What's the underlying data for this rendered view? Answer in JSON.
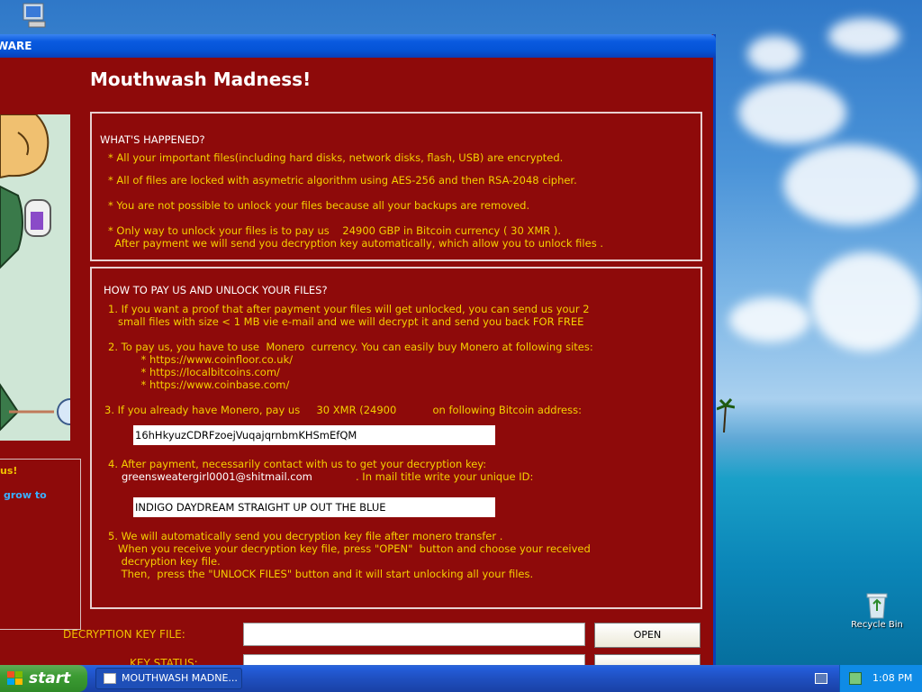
{
  "window": {
    "title": "WARE",
    "app_title": "Mouthwash Madness!"
  },
  "sidebar": {
    "text1": "us!",
    "text2": "grow to"
  },
  "what_happened": {
    "heading": "WHAT'S HAPPENED?",
    "lines": [
      "* All your important files(including hard disks, network disks, flash, USB) are encrypted.",
      "* All of files are locked with asymetric algorithm using AES-256 and then RSA-2048 cipher.",
      "* You are not possible to unlock your files because all your backups are removed.",
      "* Only way to unlock your files is to pay us    24900 GBP in Bitcoin currency ( 30 XMR ).",
      "  After payment we will send you decryption key automatically, which allow you to unlock files ."
    ]
  },
  "how_to_pay": {
    "heading": "HOW TO PAY US AND UNLOCK YOUR FILES?",
    "step1": [
      "1. If you want a proof that after payment your files will get unlocked, you can send us your 2",
      "   small files with size < 1 MB vie e-mail and we will decrypt it and send you back FOR FREE"
    ],
    "step2": [
      "2. To pay us, you have to use  Monero  currency. You can easily buy Monero at following sites:",
      "          * https://www.coinfloor.co.uk/",
      "          * https://localbitcoins.com/",
      "          * https://www.coinbase.com/"
    ],
    "step3": "3. If you already have Monero, pay us     30 XMR (24900           on following Bitcoin address:",
    "bitcoin_address": "16hHkyuzCDRFzoejVuqajqrnbmKHSmEfQM",
    "step4_line1": "4. After payment, necessarily contact with us to get your decryption key:",
    "step4_email": "greensweatergirl0001@shitmail.com",
    "step4_rest": ". In mail title write your unique ID:",
    "unique_id": "INDIGO DAYDREAM STRAIGHT UP OUT THE BLUE",
    "step5": [
      "5. We will automatically send you decryption key file after monero transfer .",
      "   When you receive your decryption key file, press \"OPEN\"  button and choose your received",
      "    decryption key file.",
      "    Then,  press the \"UNLOCK FILES\" button and it will start unlocking all your files."
    ]
  },
  "bottom": {
    "decryption_key_label": "DECRYPTION KEY FILE:",
    "key_status_label": "KEY STATUS:",
    "open_button": "OPEN"
  },
  "desktop": {
    "recycle_bin_label": "Recycle Bin"
  },
  "taskbar": {
    "start_label": "start",
    "task_item": "MOUTHWASH MADNE...",
    "clock": "1:08 PM"
  }
}
